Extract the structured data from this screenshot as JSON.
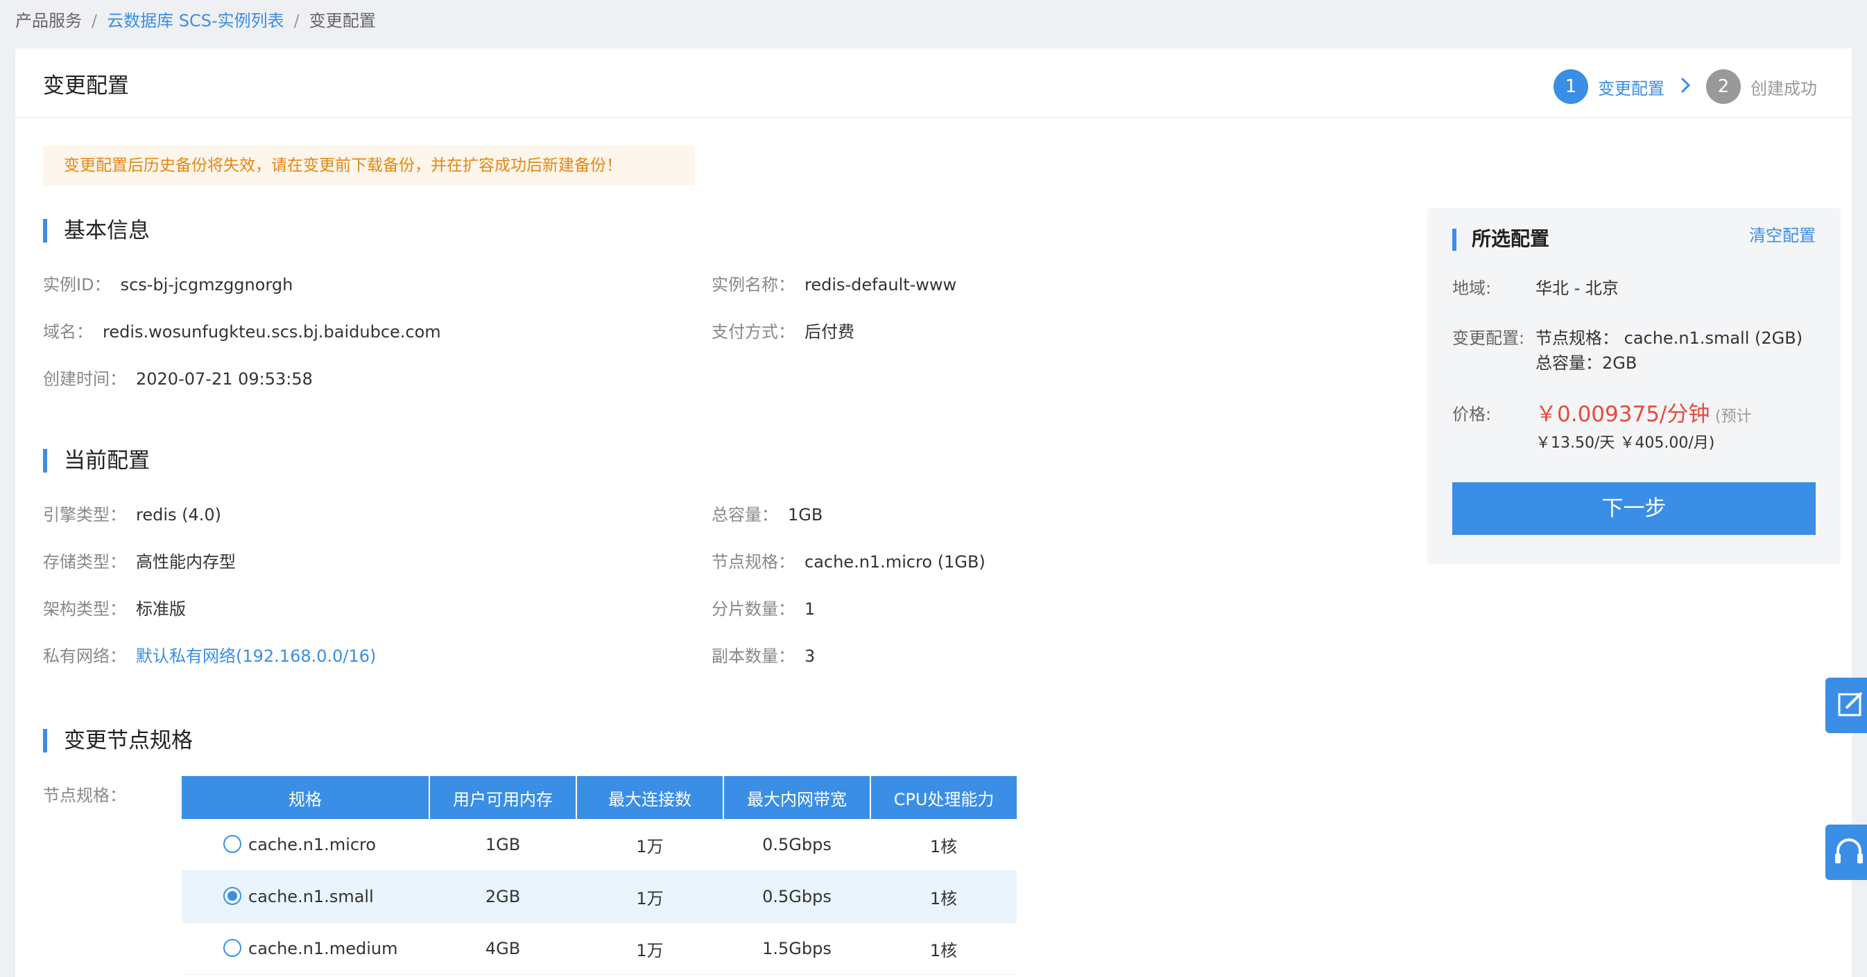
{
  "breadcrumb": {
    "item1": "产品服务",
    "item2": "云数据库 SCS-实例列表",
    "item3": "变更配置",
    "sep": "/"
  },
  "header": {
    "title": "变更配置",
    "step1": {
      "num": "1",
      "label": "变更配置"
    },
    "step2": {
      "num": "2",
      "label": "创建成功"
    }
  },
  "warning": "变更配置后历史备份将失效，请在变更前下载备份，并在扩容成功后新建备份！",
  "basic": {
    "title": "基本信息",
    "instance_id_label": "实例ID：",
    "instance_id": "scs-bj-jcgmzggnorgh",
    "instance_name_label": "实例名称：",
    "instance_name": "redis-default-www",
    "domain_label": "域名：",
    "domain": "redis.wosunfugkteu.scs.bj.baidubce.com",
    "pay_label": "支付方式：",
    "pay": "后付费",
    "created_label": "创建时间：",
    "created": "2020-07-21 09:53:58"
  },
  "current": {
    "title": "当前配置",
    "engine_label": "引擎类型：",
    "engine": "redis (4.0)",
    "capacity_label": "总容量：",
    "capacity": "1GB",
    "storage_label": "存储类型：",
    "storage": "高性能内存型",
    "node_label": "节点规格：",
    "node": "cache.n1.micro (1GB)",
    "arch_label": "架构类型：",
    "arch": "标准版",
    "shards_label": "分片数量：",
    "shards": "1",
    "vpc_label": "私有网络：",
    "vpc": "默认私有网络(192.168.0.0/16)",
    "replicas_label": "副本数量：",
    "replicas": "3"
  },
  "change": {
    "title": "变更节点规格",
    "spec_label": "节点规格：",
    "columns": [
      "规格",
      "用户可用内存",
      "最大连接数",
      "最大内网带宽",
      "CPU处理能力"
    ],
    "rows": [
      {
        "name": "cache.n1.micro",
        "memory": "1GB",
        "conns": "1万",
        "bandwidth": "0.5Gbps",
        "cpu": "1核",
        "selected": false
      },
      {
        "name": "cache.n1.small",
        "memory": "2GB",
        "conns": "1万",
        "bandwidth": "0.5Gbps",
        "cpu": "1核",
        "selected": true
      },
      {
        "name": "cache.n1.medium",
        "memory": "4GB",
        "conns": "1万",
        "bandwidth": "1.5Gbps",
        "cpu": "1核",
        "selected": false
      }
    ]
  },
  "side": {
    "title": "所选配置",
    "clear": "清空配置",
    "region_label": "地域:",
    "region": "华北 - 北京",
    "change_label": "变更配置:",
    "change_line1": "节点规格：  cache.n1.small (2GB)",
    "change_line2": "总容量：2GB",
    "price_label": "价格:",
    "price_main": "￥0.009375/分钟",
    "price_note1": "(预计",
    "price_note2": "￥13.50/天 ￥405.00/月)",
    "next": "下一步"
  },
  "colors": {
    "accent": "#3a8ee6",
    "warning_text": "#e6860f",
    "warning_bg": "#fdf6ec",
    "price": "#e84a3b"
  }
}
